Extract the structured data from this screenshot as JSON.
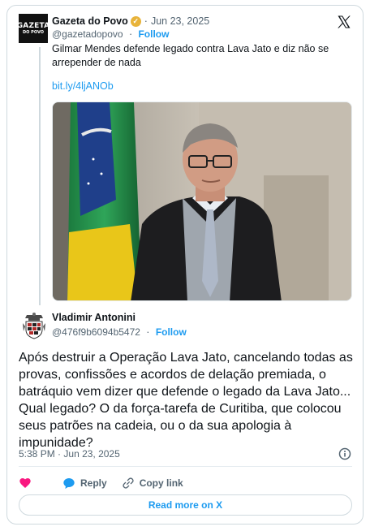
{
  "quoted": {
    "name": "Gazeta do Povo",
    "logo_text_1": "GAZETA",
    "logo_text_2": "DO POVO",
    "date": "Jun 23, 2025",
    "handle": "@gazetadopovo",
    "follow_label": "Follow",
    "text": "Gilmar Mendes defende legado contra Lava Jato e diz não se arrepender de nada",
    "link": "bit.ly/4ljANOb",
    "verified_icon": "verified-badge-icon",
    "image_alt": "photo-of-man-in-judicial-robe-with-flag"
  },
  "author": {
    "name": "Vladimir Antonini",
    "handle": "@476f9b6094b5472",
    "follow_label": "Follow"
  },
  "post": {
    "text": "Após destruir a Operação Lava Jato, cancelando todas as provas, confissões e acordos de delação premiada, o batráquio vem dizer que defende o legado da Lava Jato... Qual legado? O da força-tarefa de Curitiba, que colocou seus patrões na cadeia, ou o da sua apologia à impunidade?",
    "time": "5:38 PM",
    "date": "Jun 23, 2025"
  },
  "actions": {
    "reply_label": "Reply",
    "copy_label": "Copy link",
    "read_more_label": "Read more on X"
  },
  "colors": {
    "accent": "#1d9bf0",
    "like": "#f91880",
    "verified": "#e8b33a"
  }
}
